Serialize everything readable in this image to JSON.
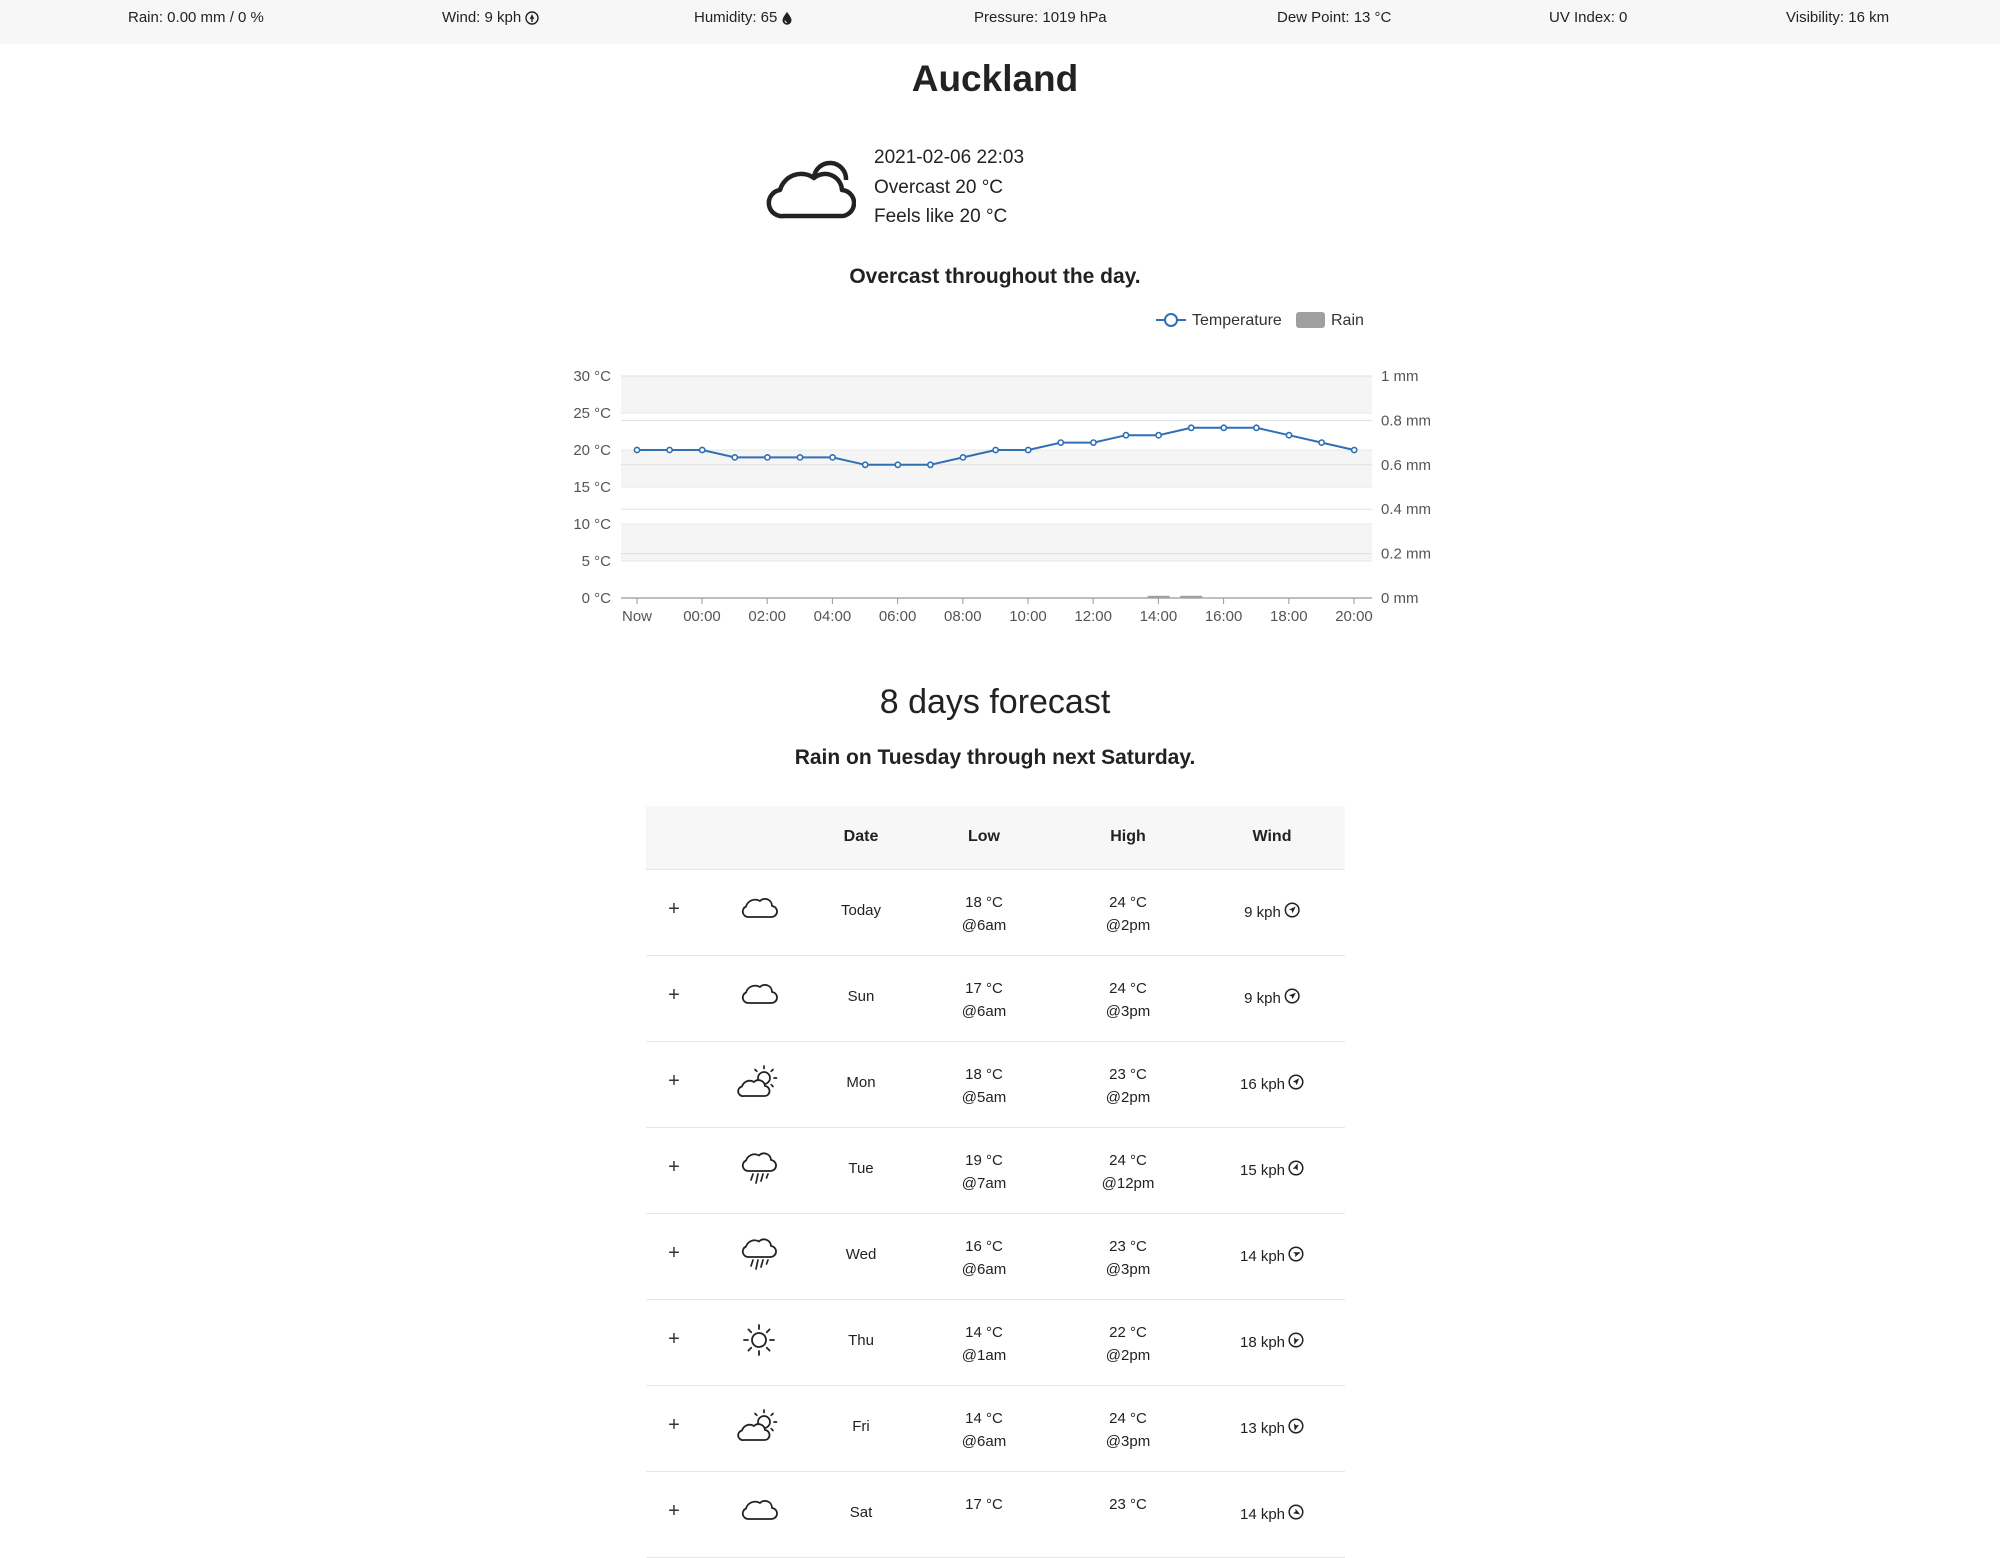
{
  "top_stats": {
    "rain": "Rain: 0.00 mm / 0 %",
    "wind": "Wind: 9 kph",
    "humidity": "Humidity: 65",
    "pressure": "Pressure: 1019 hPa",
    "dew_point": "Dew Point: 13 °C",
    "uv_index": "UV Index: 0",
    "visibility": "Visibility: 16 km"
  },
  "city": "Auckland",
  "current": {
    "icon": "cloud-icon",
    "datetime": "2021-02-06 22:03",
    "condition": "Overcast 20 °C",
    "feels_like": "Feels like 20 °C"
  },
  "today_summary": "Overcast throughout the day.",
  "chart_data": {
    "type": "line",
    "legend": {
      "placement": "top-right",
      "entries": [
        "Temperature",
        "Rain"
      ]
    },
    "x_tick_labels": [
      "Now",
      "00:00",
      "02:00",
      "04:00",
      "06:00",
      "08:00",
      "10:00",
      "12:00",
      "14:00",
      "16:00",
      "18:00",
      "20:00"
    ],
    "y_left_ticks": [
      "0 °C",
      "5 °C",
      "10 °C",
      "15 °C",
      "20 °C",
      "25 °C",
      "30 °C"
    ],
    "y_right_ticks": [
      "0 mm",
      "0.2 mm",
      "0.4 mm",
      "0.6 mm",
      "0.8 mm",
      "1 mm"
    ],
    "ylim_left": [
      0,
      30
    ],
    "ylim_right": [
      0,
      1
    ],
    "grid": true,
    "series": [
      {
        "name": "Temperature",
        "color": "#2f6fb4",
        "values": [
          20,
          20,
          20,
          19,
          19,
          19,
          19,
          18,
          18,
          18,
          19,
          20,
          20,
          21,
          21,
          22,
          22,
          23,
          23,
          23,
          22,
          21,
          20
        ]
      },
      {
        "name": "Rain",
        "color": "#a0a0a0",
        "values": [
          0,
          0,
          0,
          0,
          0,
          0,
          0,
          0,
          0,
          0,
          0,
          0,
          0,
          0,
          0,
          0,
          0.01,
          0.01,
          0,
          0,
          0,
          0,
          0
        ]
      }
    ]
  },
  "forecast": {
    "title": "8 days forecast",
    "summary": "Rain on Tuesday through next Saturday.",
    "headers": {
      "date": "Date",
      "low": "Low",
      "high": "High",
      "wind": "Wind"
    },
    "rows": [
      {
        "icon": "cloud-icon",
        "day": "Today",
        "low": "18 °C",
        "low_time": "@6am",
        "high": "24 °C",
        "high_time": "@2pm",
        "wind": "9 kph",
        "wind_deg": 45
      },
      {
        "icon": "cloud-icon",
        "day": "Sun",
        "low": "17 °C",
        "low_time": "@6am",
        "high": "24 °C",
        "high_time": "@3pm",
        "wind": "9 kph",
        "wind_deg": 50
      },
      {
        "icon": "partly-cloudy-icon",
        "day": "Mon",
        "low": "18 °C",
        "low_time": "@5am",
        "high": "23 °C",
        "high_time": "@2pm",
        "wind": "16 kph",
        "wind_deg": 40
      },
      {
        "icon": "rain-icon",
        "day": "Tue",
        "low": "19 °C",
        "low_time": "@7am",
        "high": "24 °C",
        "high_time": "@12pm",
        "wind": "15 kph",
        "wind_deg": 20
      },
      {
        "icon": "rain-icon",
        "day": "Wed",
        "low": "16 °C",
        "low_time": "@6am",
        "high": "23 °C",
        "high_time": "@3pm",
        "wind": "14 kph",
        "wind_deg": 70
      },
      {
        "icon": "sun-icon",
        "day": "Thu",
        "low": "14 °C",
        "low_time": "@1am",
        "high": "22 °C",
        "high_time": "@2pm",
        "wind": "18 kph",
        "wind_deg": 200
      },
      {
        "icon": "partly-cloudy-icon",
        "day": "Fri",
        "low": "14 °C",
        "low_time": "@6am",
        "high": "24 °C",
        "high_time": "@3pm",
        "wind": "13 kph",
        "wind_deg": 195
      },
      {
        "icon": "cloud-icon",
        "day": "Sat",
        "low": "17 °C",
        "low_time": "",
        "high": "23 °C",
        "high_time": "",
        "wind": "14 kph",
        "wind_deg": 120
      }
    ]
  }
}
